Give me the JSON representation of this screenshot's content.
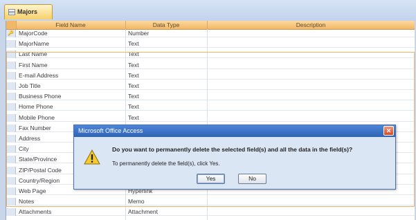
{
  "tab": {
    "title": "Majors"
  },
  "grid": {
    "headers": {
      "field": "Field Name",
      "type": "Data Type",
      "description": "Description"
    },
    "rows": [
      {
        "marker": "🔑",
        "field": "MajorCode",
        "type": "Number"
      },
      {
        "marker": "",
        "field": "MajorName",
        "type": "Text"
      },
      {
        "marker": "",
        "field": "Last Name",
        "type": "Text"
      },
      {
        "marker": "",
        "field": "First Name",
        "type": "Text"
      },
      {
        "marker": "",
        "field": "E-mail Address",
        "type": "Text"
      },
      {
        "marker": "",
        "field": "Job Title",
        "type": "Text"
      },
      {
        "marker": "",
        "field": "Business Phone",
        "type": "Text"
      },
      {
        "marker": "",
        "field": "Home Phone",
        "type": "Text"
      },
      {
        "marker": "",
        "field": "Mobile Phone",
        "type": "Text"
      },
      {
        "marker": "",
        "field": "Fax Number",
        "type": ""
      },
      {
        "marker": "",
        "field": "Address",
        "type": ""
      },
      {
        "marker": "",
        "field": "City",
        "type": ""
      },
      {
        "marker": "",
        "field": "State/Province",
        "type": ""
      },
      {
        "marker": "",
        "field": "ZIP/Postal Code",
        "type": ""
      },
      {
        "marker": "",
        "field": "Country/Region",
        "type": ""
      },
      {
        "marker": "",
        "field": "Web Page",
        "type": "Hyperlink"
      },
      {
        "marker": "",
        "field": "Notes",
        "type": "Memo"
      },
      {
        "marker": "",
        "field": "Attachments",
        "type": "Attachment"
      }
    ]
  },
  "dialog": {
    "title": "Microsoft Office Access",
    "question": "Do you want to permanently delete the selected field(s) and all the data in the field(s)?",
    "instruction": "To permanently delete the field(s), click Yes.",
    "yes_label": "Yes",
    "no_label": "No",
    "close_glyph": "✕",
    "icon": "warning-icon"
  }
}
